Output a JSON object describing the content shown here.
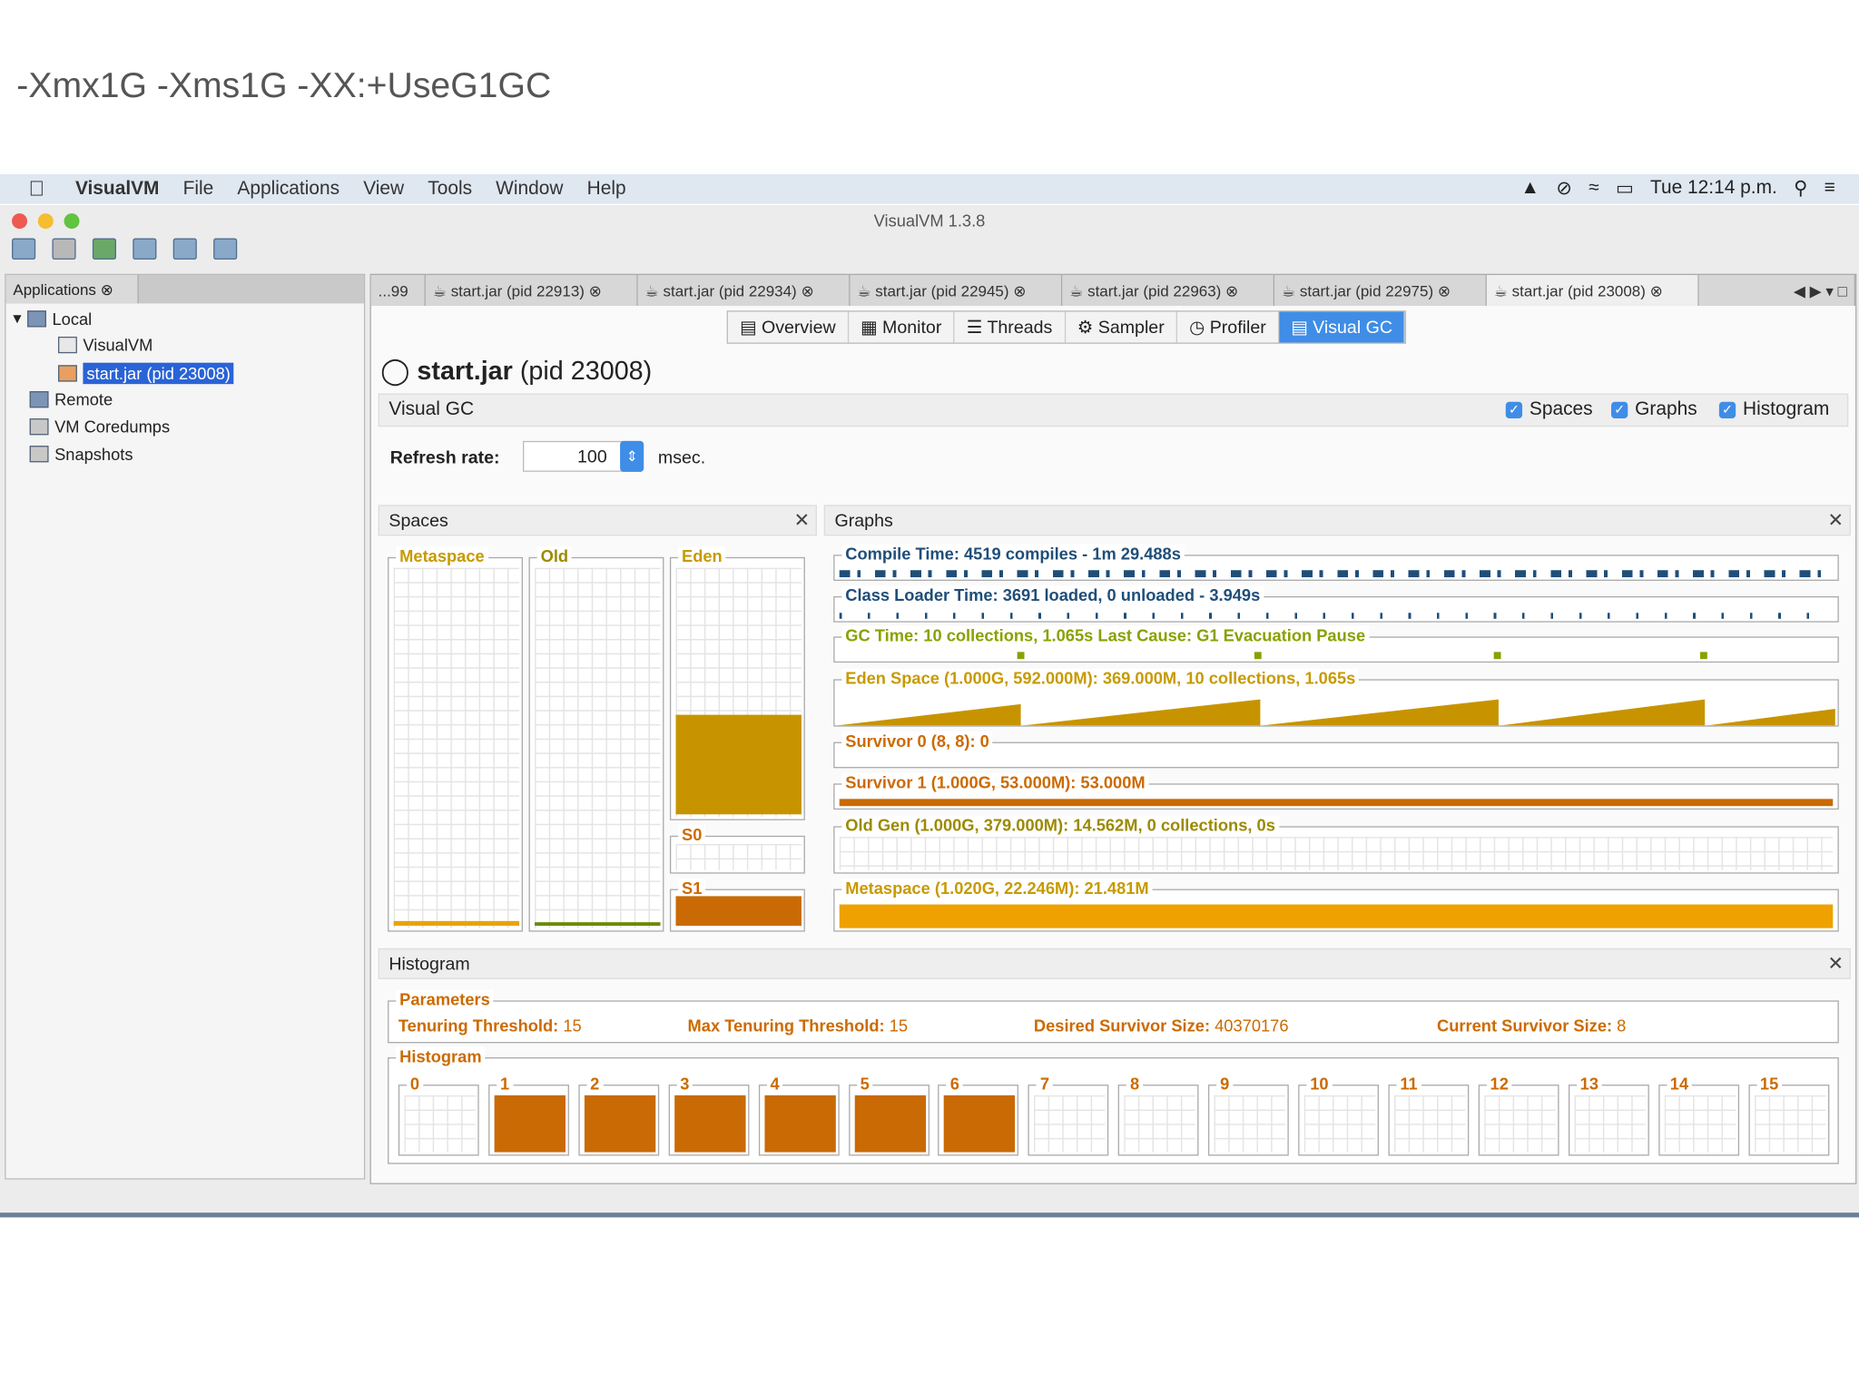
{
  "caption": "-Xmx1G -Xms1G -XX:+UseG1GC",
  "menubar": {
    "app": "VisualVM",
    "items": [
      "File",
      "Applications",
      "View",
      "Tools",
      "Window",
      "Help"
    ],
    "clock": "Tue 12:14 p.m."
  },
  "window": {
    "title": "VisualVM 1.3.8"
  },
  "left": {
    "tab": "Applications",
    "local": "Local",
    "visualvm": "VisualVM",
    "selected": "start.jar (pid 23008)",
    "remote": "Remote",
    "coredumps": "VM Coredumps",
    "snapshots": "Snapshots"
  },
  "tabs": [
    "...99",
    "start.jar (pid 22913)",
    "start.jar (pid 22934)",
    "start.jar (pid 22945)",
    "start.jar (pid 22963)",
    "start.jar (pid 22975)",
    "start.jar (pid 23008)"
  ],
  "subtabs": [
    "Overview",
    "Monitor",
    "Threads",
    "Sampler",
    "Profiler",
    "Visual GC"
  ],
  "page": {
    "title_bold": "start.jar",
    "title_rest": "(pid 23008)",
    "section": "Visual GC",
    "spaces": "Spaces",
    "graphs": "Graphs",
    "histogram": "Histogram",
    "refresh_label": "Refresh rate:",
    "refresh_value": "100",
    "refresh_unit": "msec."
  },
  "spaces_panel": {
    "title": "Spaces",
    "metaspace": "Metaspace",
    "old": "Old",
    "eden": "Eden",
    "s0": "S0",
    "s1": "S1",
    "eden_fill": 0.4,
    "s1_fill": 0.9
  },
  "graphs_panel": {
    "title": "Graphs",
    "rows": [
      "Compile Time: 4519 compiles - 1m 29.488s",
      "Class Loader Time: 3691 loaded, 0 unloaded - 3.949s",
      "GC Time: 10 collections, 1.065s  Last Cause: G1 Evacuation Pause",
      "Eden Space (1.000G, 592.000M): 369.000M, 10 collections, 1.065s",
      "Survivor 0 (8, 8): 0",
      "Survivor 1 (1.000G, 53.000M): 53.000M",
      "Old Gen (1.000G, 379.000M): 14.562M, 0 collections, 0s",
      "Metaspace (1.020G, 22.246M): 21.481M"
    ]
  },
  "histogram_panel": {
    "title": "Histogram",
    "params_label": "Parameters",
    "tt_label": "Tenuring Threshold:",
    "tt": "15",
    "mtt_label": "Max Tenuring Threshold:",
    "mtt": "15",
    "dss_label": "Desired Survivor Size:",
    "dss": "40370176",
    "css_label": "Current Survivor Size:",
    "css": "8",
    "hist_label": "Histogram",
    "bins": [
      "0",
      "1",
      "2",
      "3",
      "4",
      "5",
      "6",
      "7",
      "8",
      "9",
      "10",
      "11",
      "12",
      "13",
      "14",
      "15"
    ],
    "filled": [
      false,
      true,
      true,
      true,
      true,
      true,
      true,
      false,
      false,
      false,
      false,
      false,
      false,
      false,
      false,
      false
    ]
  }
}
